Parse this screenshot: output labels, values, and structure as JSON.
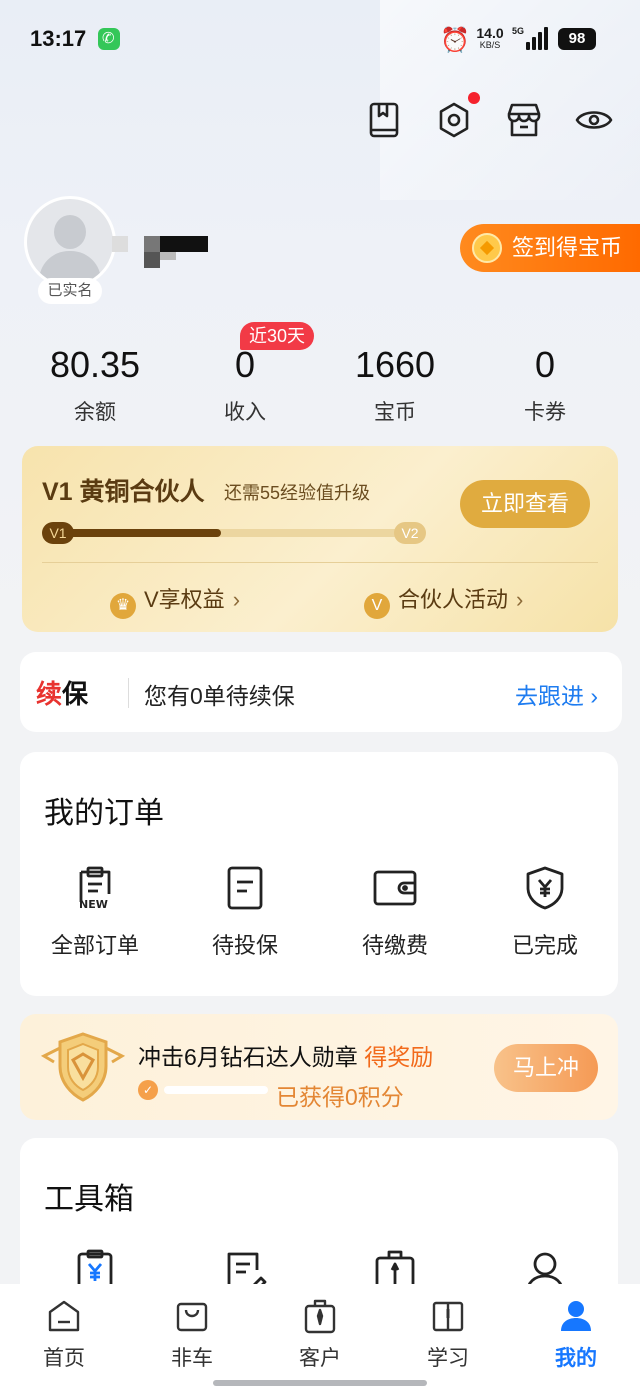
{
  "status_bar": {
    "time": "13:17",
    "speed_value": "14.0",
    "speed_unit": "KB/S",
    "network": "5G",
    "battery": "98",
    "icons": [
      "phone-call-icon",
      "alarm-icon",
      "signal-icon",
      "battery-icon"
    ]
  },
  "top_icons": [
    "book-icon",
    "settings-icon",
    "store-icon",
    "eye-icon"
  ],
  "profile": {
    "verified_label": "已实名",
    "checkin_label": "签到得宝币"
  },
  "stats": [
    {
      "value": "80.35",
      "label": "余额"
    },
    {
      "value": "0",
      "label": "收入",
      "badge": "近30天"
    },
    {
      "value": "1660",
      "label": "宝币"
    },
    {
      "value": "0",
      "label": "卡券"
    }
  ],
  "partner": {
    "title": "V1 黄铜合伙人",
    "subtitle": "还需55经验值升级",
    "button": "立即查看",
    "level_from": "V1",
    "level_to": "V2",
    "progress": 0.47,
    "link_benefits": "V享权益",
    "link_activities": "合伙人活动",
    "colors": {
      "accent": "#e0ab3f",
      "fill": "#6b420c"
    }
  },
  "renewal": {
    "tag_a": "续",
    "tag_b": "保",
    "text": "您有0单待续保",
    "action": "去跟进"
  },
  "orders": {
    "title": "我的订单",
    "items": [
      {
        "label": "全部订单",
        "icon": "clipboard-new-icon"
      },
      {
        "label": "待投保",
        "icon": "document-icon"
      },
      {
        "label": "待缴费",
        "icon": "wallet-icon"
      },
      {
        "label": "已完成",
        "icon": "shield-yen-icon"
      }
    ]
  },
  "medal": {
    "title": "冲击6月钻石达人勋章 ",
    "highlight": "得奖励",
    "points": "已获得0积分",
    "button": "马上冲",
    "progress": 0
  },
  "toolbox": {
    "title": "工具箱",
    "icons": [
      "clipboard-yen-icon",
      "document-edit-icon",
      "briefcase-icon",
      "user-icon"
    ]
  },
  "bottom_nav": [
    {
      "label": "首页",
      "icon": "home-icon"
    },
    {
      "label": "非车",
      "icon": "bag-icon"
    },
    {
      "label": "客户",
      "icon": "client-icon"
    },
    {
      "label": "学习",
      "icon": "book-open-icon"
    },
    {
      "label": "我的",
      "icon": "person-icon",
      "active": true
    }
  ],
  "colors": {
    "brand_blue": "#1677ff",
    "link_blue": "#1e7cf0",
    "orange": "#ff6a00",
    "badge_red": "#f23a46"
  }
}
